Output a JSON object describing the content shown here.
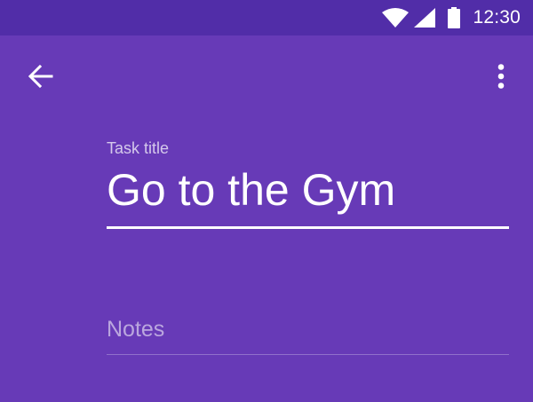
{
  "status_bar": {
    "time": "12:30",
    "icons": [
      "wifi-icon",
      "signal-icon",
      "battery-icon"
    ]
  },
  "app_bar": {
    "back_icon": "arrow-left-icon",
    "overflow_icon": "more-vert-icon"
  },
  "form": {
    "title_label": "Task title",
    "title_value": "Go to the Gym",
    "notes_placeholder": "Notes",
    "notes_value": ""
  },
  "colors": {
    "primary": "#673ab7",
    "primary_dark": "#512da8",
    "on_primary": "#ffffff"
  }
}
